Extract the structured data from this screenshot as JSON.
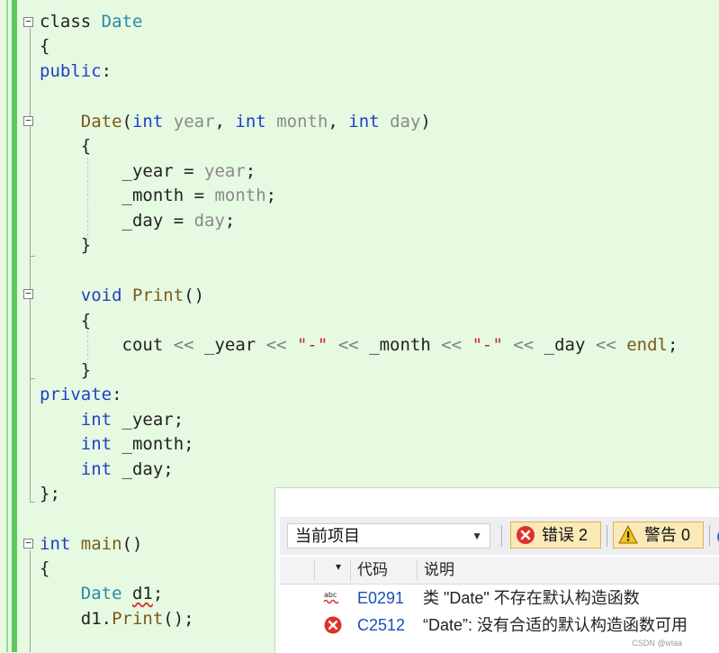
{
  "editor": {
    "lines": [
      {
        "segments": [
          [
            "kw",
            ""
          ],
          [
            "plain",
            "class "
          ],
          [
            "ty",
            "Date"
          ]
        ]
      },
      {
        "segments": [
          [
            "plain",
            "{"
          ]
        ]
      },
      {
        "segments": [
          [
            "kw",
            "public"
          ],
          [
            "plain",
            ":"
          ]
        ]
      },
      {
        "segments": []
      },
      {
        "segments": [
          [
            "plain",
            "    "
          ],
          [
            "fn",
            "Date"
          ],
          [
            "plain",
            "("
          ],
          [
            "kw",
            "int"
          ],
          [
            "plain",
            " "
          ],
          [
            "pm",
            "year"
          ],
          [
            "plain",
            ", "
          ],
          [
            "kw",
            "int"
          ],
          [
            "plain",
            " "
          ],
          [
            "pm",
            "month"
          ],
          [
            "plain",
            ", "
          ],
          [
            "kw",
            "int"
          ],
          [
            "plain",
            " "
          ],
          [
            "pm",
            "day"
          ],
          [
            "plain",
            ")"
          ]
        ]
      },
      {
        "segments": [
          [
            "plain",
            "    {"
          ]
        ]
      },
      {
        "segments": [
          [
            "plain",
            "        _year = "
          ],
          [
            "pm",
            "year"
          ],
          [
            "plain",
            ";"
          ]
        ]
      },
      {
        "segments": [
          [
            "plain",
            "        _month = "
          ],
          [
            "pm",
            "month"
          ],
          [
            "plain",
            ";"
          ]
        ]
      },
      {
        "segments": [
          [
            "plain",
            "        _day = "
          ],
          [
            "pm",
            "day"
          ],
          [
            "plain",
            ";"
          ]
        ]
      },
      {
        "segments": [
          [
            "plain",
            "    }"
          ]
        ]
      },
      {
        "segments": []
      },
      {
        "segments": [
          [
            "plain",
            "    "
          ],
          [
            "kw",
            "void"
          ],
          [
            "plain",
            " "
          ],
          [
            "fn",
            "Print"
          ],
          [
            "plain",
            "()"
          ]
        ]
      },
      {
        "segments": [
          [
            "plain",
            "    {"
          ]
        ]
      },
      {
        "segments": [
          [
            "plain",
            "        cout "
          ],
          [
            "op",
            "<<"
          ],
          [
            "plain",
            " _year "
          ],
          [
            "op",
            "<<"
          ],
          [
            "plain",
            " "
          ],
          [
            "str",
            "\"-\""
          ],
          [
            "plain",
            " "
          ],
          [
            "op",
            "<<"
          ],
          [
            "plain",
            " _month "
          ],
          [
            "op",
            "<<"
          ],
          [
            "plain",
            " "
          ],
          [
            "str",
            "\"-\""
          ],
          [
            "plain",
            " "
          ],
          [
            "op",
            "<<"
          ],
          [
            "plain",
            " _day "
          ],
          [
            "op",
            "<<"
          ],
          [
            "plain",
            " "
          ],
          [
            "fn",
            "endl"
          ],
          [
            "plain",
            ";"
          ]
        ]
      },
      {
        "segments": [
          [
            "plain",
            "    }"
          ]
        ]
      },
      {
        "segments": [
          [
            "kw",
            "private"
          ],
          [
            "plain",
            ":"
          ]
        ]
      },
      {
        "segments": [
          [
            "plain",
            "    "
          ],
          [
            "kw",
            "int"
          ],
          [
            "plain",
            " _year;"
          ]
        ]
      },
      {
        "segments": [
          [
            "plain",
            "    "
          ],
          [
            "kw",
            "int"
          ],
          [
            "plain",
            " _month;"
          ]
        ]
      },
      {
        "segments": [
          [
            "plain",
            "    "
          ],
          [
            "kw",
            "int"
          ],
          [
            "plain",
            " _day;"
          ]
        ]
      },
      {
        "segments": [
          [
            "plain",
            "};"
          ]
        ]
      },
      {
        "segments": []
      },
      {
        "segments": [
          [
            "kw",
            "int"
          ],
          [
            "plain",
            " "
          ],
          [
            "fn",
            "main"
          ],
          [
            "plain",
            "()"
          ]
        ]
      },
      {
        "segments": [
          [
            "plain",
            "{"
          ]
        ]
      },
      {
        "segments": [
          [
            "plain",
            "    "
          ],
          [
            "ty",
            "Date"
          ],
          [
            "plain",
            " "
          ],
          [
            "err",
            "d1"
          ],
          [
            "plain",
            ";"
          ]
        ]
      },
      {
        "segments": [
          [
            "plain",
            "    d1."
          ],
          [
            "fn",
            "Print"
          ],
          [
            "plain",
            "();"
          ]
        ]
      }
    ]
  },
  "error_list": {
    "scope_label": "当前项目",
    "errors_button": "错误 2",
    "warnings_button": "警告 0",
    "columns": {
      "code": "代码",
      "description": "说明"
    },
    "rows": [
      {
        "icon": "intellisense-error-icon",
        "code": "E0291",
        "description": "类 \"Date\" 不存在默认构造函数"
      },
      {
        "icon": "error-circle-icon",
        "code": "C2512",
        "description": "“Date”: 没有合适的默认构造函数可用"
      }
    ]
  },
  "watermark": "CSDN @wlaa",
  "colors": {
    "editor_bg": "#e6f9e1",
    "keyword": "#1f3fc7",
    "type": "#2b8aa8",
    "error": "#e0302a"
  }
}
